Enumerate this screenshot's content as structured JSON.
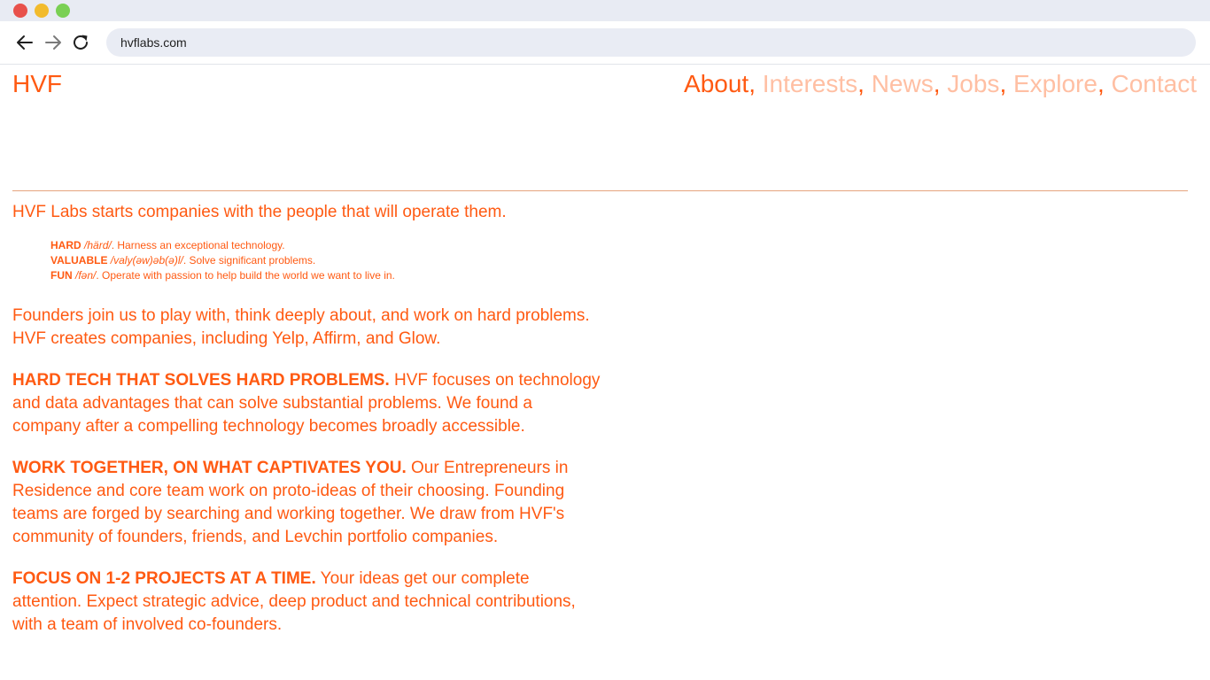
{
  "browser": {
    "url": "hvflabs.com",
    "icons": {
      "back": "arrow-left-icon",
      "forward": "arrow-right-icon",
      "reload": "reload-icon"
    }
  },
  "site": {
    "logo": "HVF",
    "nav": [
      {
        "label": "About"
      },
      {
        "label": "Interests"
      },
      {
        "label": "News"
      },
      {
        "label": "Jobs"
      },
      {
        "label": "Explore"
      },
      {
        "label": "Contact"
      }
    ],
    "nav_separator": ", "
  },
  "content": {
    "intro": "HVF Labs starts companies with the people that will operate them.",
    "definitions": [
      {
        "term": "HARD",
        "pron": "/härd/",
        "text": ". Harness an exceptional technology."
      },
      {
        "term": "VALUABLE",
        "pron": "/valy(əw)əb(ə)l/",
        "text": ". Solve significant problems."
      },
      {
        "term": "FUN",
        "pron": "/fən/",
        "text": ". Operate with passion to help build the world we want to live in."
      }
    ],
    "founders": "Founders join us to play with, think deeply about, and work on hard problems. HVF creates companies, including Yelp, Affirm, and Glow.",
    "sections": [
      {
        "heading": "HARD TECH THAT SOLVES HARD PROBLEMS.",
        "body": " HVF focuses on technology and data advantages that can solve substantial problems. We found a company after a compelling technology becomes broadly accessible."
      },
      {
        "heading": "WORK TOGETHER, ON WHAT CAPTIVATES YOU.",
        "body": " Our Entrepreneurs in Residence and core team work on proto-ideas of their choosing. Founding teams are forged by searching and working together. We draw from HVF's community of founders, friends, and Levchin portfolio companies."
      },
      {
        "heading": "FOCUS ON 1-2 PROJECTS AT A TIME.",
        "body": " Your ideas get our complete attention. Expect strategic advice, deep product and technical contributions, with a team of involved co-founders."
      }
    ]
  },
  "colors": {
    "accent": "#ff5a12",
    "nav_inactive": "#ffbfa3",
    "divider": "#e6a47e"
  }
}
